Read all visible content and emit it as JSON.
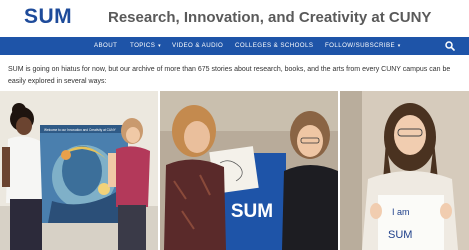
{
  "header": {
    "logo": "SUM",
    "tagline": "Research, Innovation, and Creativity at CUNY"
  },
  "nav": {
    "items": [
      {
        "label": "ABOUT",
        "has_caret": false
      },
      {
        "label": "TOPICS",
        "has_caret": true
      },
      {
        "label": "VIDEO & AUDIO",
        "has_caret": false
      },
      {
        "label": "COLLEGES & SCHOOLS",
        "has_caret": false
      },
      {
        "label": "FOLLOW/SUBSCRIBE",
        "has_caret": true
      }
    ],
    "search_icon": "search-icon",
    "background": "#1e54a8"
  },
  "intro": {
    "text": "SUM is going on hiatus for now, but our archive of more than 675 stories about research, books, and the arts from every CUNY campus can be easily explored in several ways:"
  },
  "photos": {
    "left": {
      "poster_text": "Welcome to our Innovation and Creativity at CUNY"
    },
    "center": {
      "sign_text": "SUM"
    },
    "right": {
      "sign_line1": "I am",
      "sign_line2": "SUM"
    }
  },
  "colors": {
    "brand": "#1e4b9a",
    "nav": "#1e54a8"
  }
}
